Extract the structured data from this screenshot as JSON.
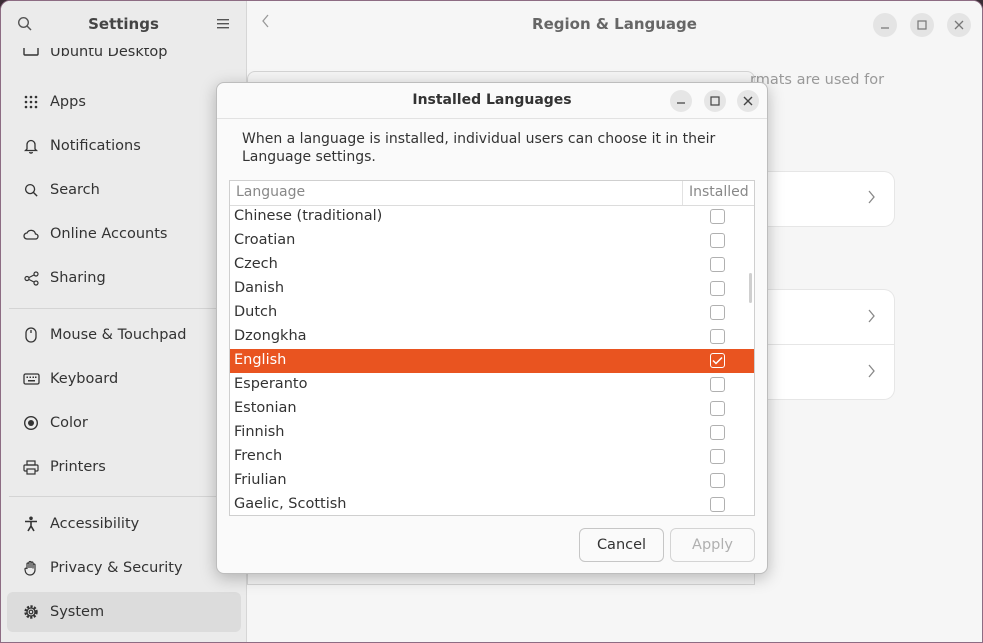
{
  "sidebar": {
    "title": "Settings",
    "partial_item": "Ubuntu Desktop",
    "items": [
      {
        "label": "Apps",
        "icon": "apps-grid-icon"
      },
      {
        "label": "Notifications",
        "icon": "bell-icon"
      },
      {
        "label": "Search",
        "icon": "search-icon"
      },
      {
        "label": "Online Accounts",
        "icon": "cloud-icon"
      },
      {
        "label": "Sharing",
        "icon": "share-icon"
      },
      {
        "label": "Mouse & Touchpad",
        "icon": "mouse-icon"
      },
      {
        "label": "Keyboard",
        "icon": "keyboard-icon"
      },
      {
        "label": "Color",
        "icon": "color-icon"
      },
      {
        "label": "Printers",
        "icon": "printer-icon"
      },
      {
        "label": "Accessibility",
        "icon": "accessibility-icon"
      },
      {
        "label": "Privacy & Security",
        "icon": "hand-icon"
      },
      {
        "label": "System",
        "icon": "gear-icon"
      }
    ],
    "active": "System"
  },
  "main": {
    "title": "Region & Language",
    "partial_text": "rmats are used for"
  },
  "dialog": {
    "title": "Installed Languages",
    "description": "When a language is installed, individual users can choose it in their Language settings.",
    "columns": {
      "language": "Language",
      "installed": "Installed"
    },
    "languages": [
      {
        "name": "Chinese (traditional)",
        "installed": false
      },
      {
        "name": "Croatian",
        "installed": false
      },
      {
        "name": "Czech",
        "installed": false
      },
      {
        "name": "Danish",
        "installed": false
      },
      {
        "name": "Dutch",
        "installed": false
      },
      {
        "name": "Dzongkha",
        "installed": false
      },
      {
        "name": "English",
        "installed": true,
        "selected": true
      },
      {
        "name": "Esperanto",
        "installed": false
      },
      {
        "name": "Estonian",
        "installed": false
      },
      {
        "name": "Finnish",
        "installed": false
      },
      {
        "name": "French",
        "installed": false
      },
      {
        "name": "Friulian",
        "installed": false
      },
      {
        "name": "Gaelic, Scottish",
        "installed": false
      }
    ],
    "cancel_label": "Cancel",
    "apply_label": "Apply"
  },
  "colors": {
    "accent": "#e95420"
  }
}
